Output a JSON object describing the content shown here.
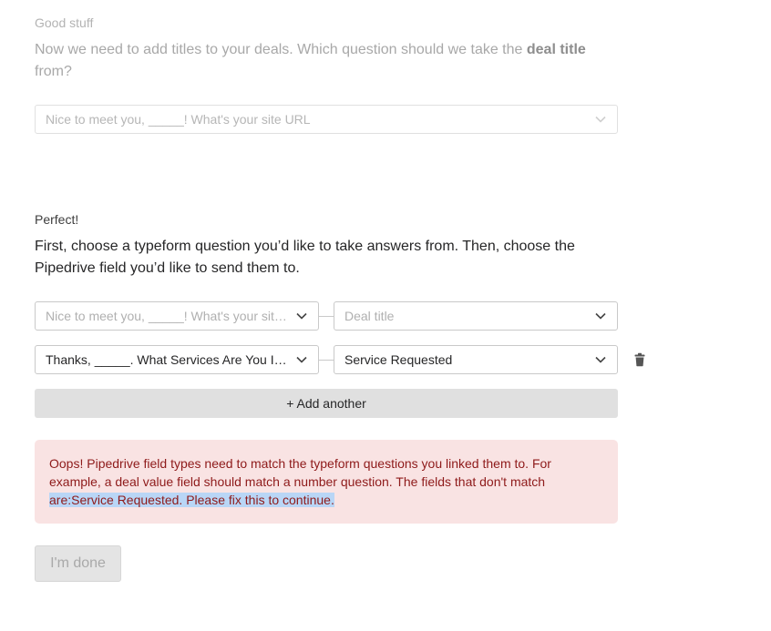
{
  "title_step": {
    "eyebrow": "Good stuff",
    "question_prefix": "Now we need to add titles to your deals. Which question should we take the ",
    "question_bold": "deal title",
    "question_suffix": " from?",
    "select_value": "Nice to meet you, _____! What's your site URL"
  },
  "mapping_step": {
    "eyebrow": "Perfect!",
    "question": "First, choose a typeform question you’d like to take answers from. Then, choose the Pipedrive field you’d like to send them to.",
    "rows": [
      {
        "question": "Nice to meet you, _____! What's your site URL",
        "field": "Deal title",
        "question_is_placeholder": true,
        "field_is_placeholder": true
      },
      {
        "question": "Thanks, _____. What Services Are You Interested In?",
        "field": "Service Requested",
        "question_is_placeholder": false,
        "field_is_placeholder": false
      }
    ],
    "add_another_label": "+ Add another",
    "error": {
      "text_before": "Oops! Pipedrive field types need to match the typeform questions you linked them to. For example, a deal value field should match a number question. The fields that don't match ",
      "text_highlighted": "are:Service Requested. Please fix this to continue."
    },
    "done_label": "I'm done"
  },
  "icons": {
    "chevron": "chevron-down-icon",
    "trash": "trash-icon"
  },
  "colors": {
    "error_bg": "#f9e3e3",
    "error_text": "#8e1a1a",
    "highlight": "#b9d6f6"
  }
}
